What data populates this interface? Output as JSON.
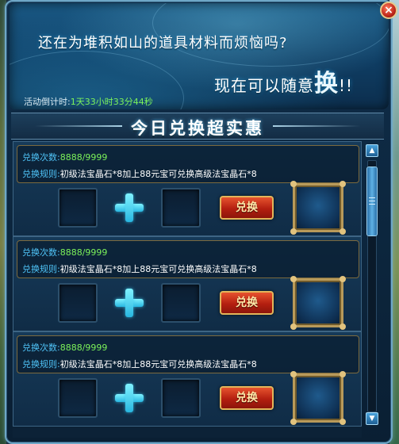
{
  "banner": {
    "headline_line1": "还在为堆积如山的道具材料而烦恼吗?",
    "headline_line2_prefix": "现在可以随意",
    "headline_line2_big": "换",
    "headline_line2_suffix": "!!",
    "countdown_label": "活动倒计时:",
    "countdown_value": "1天33小时33分44秒"
  },
  "window": {
    "close_glyph": "×",
    "close_icon": "close-icon"
  },
  "section": {
    "title": "今日兑换超实惠"
  },
  "exchange_items": [
    {
      "count_label": "兑换次数:",
      "count_value": "8888/9999",
      "rule_label": "兑换规则:",
      "rule_text": "初级法宝晶石*8加上88元宝可兑换高级法宝晶石*8",
      "button_label": "兑换"
    },
    {
      "count_label": "兑换次数:",
      "count_value": "8888/9999",
      "rule_label": "兑换规则:",
      "rule_text": "初级法宝晶石*8加上88元宝可兑换高级法宝晶石*8",
      "button_label": "兑换"
    },
    {
      "count_label": "兑换次数:",
      "count_value": "8888/9999",
      "rule_label": "兑换规则:",
      "rule_text": "初级法宝晶石*8加上88元宝可兑换高级法宝晶石*8",
      "button_label": "兑换"
    }
  ],
  "icons": {
    "plus": "plus-icon",
    "scroll_up": "arrow-up-icon",
    "scroll_down": "arrow-down-icon"
  },
  "colors": {
    "label_blue": "#4fc3f7",
    "count_green": "#7cf25a",
    "button_red": "#b41f10",
    "frame_gold": "#b89a5a"
  }
}
